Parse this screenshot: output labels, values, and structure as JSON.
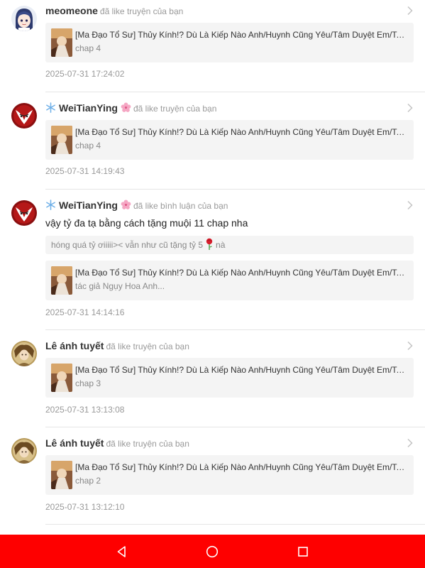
{
  "notifications": [
    {
      "username": "meomeone",
      "action": "đã like truyện của bạn",
      "avatar": "chibi-avatar",
      "book_title": "[Ma Đạo Tổ Sư] Thủy Kính!? Dù Là Kiếp Nào Anh/Huynh Cũng Yêu/Tâm Duyệt Em/Ta Đa...",
      "book_subtitle": "chap 4",
      "timestamp": "2025-07-31 17:24:02"
    },
    {
      "username": "WeiTianYing",
      "action": "đã like truyện của bạn",
      "avatar": "red-fox-avatar",
      "book_title": "[Ma Đạo Tổ Sư] Thủy Kính!? Dù Là Kiếp Nào Anh/Huynh Cũng Yêu/Tâm Duyệt Em/Ta Đa...",
      "book_subtitle": "chap 4",
      "timestamp": "2025-07-31 14:19:43"
    },
    {
      "username": "WeiTianYing",
      "action": "đã like bình luận của bạn",
      "avatar": "red-fox-avatar",
      "comment": "vậy tỷ đa tạ bằng cách tặng muội 11 chap nha",
      "quote_before": "hóng quá tỷ ơiiiii>< vẫn như cũ tặng tỷ 5",
      "quote_after": "nà",
      "book_title": "[Ma Đạo Tổ Sư] Thủy Kính!? Dù Là Kiếp Nào Anh/Huynh Cũng Yêu/Tâm Duyệt Em/Ta Đa...",
      "book_subtitle": "tác giả Ngụy Hoa Anh...",
      "timestamp": "2025-07-31 14:14:16"
    },
    {
      "username": "Lê ánh tuyết",
      "action": "đã like truyện của bạn",
      "avatar": "golden-portrait-avatar",
      "book_title": "[Ma Đạo Tổ Sư] Thủy Kính!? Dù Là Kiếp Nào Anh/Huynh Cũng Yêu/Tâm Duyệt Em/Ta Đa...",
      "book_subtitle": "chap 3",
      "timestamp": "2025-07-31 13:13:08"
    },
    {
      "username": "Lê ánh tuyết",
      "action": "đã like truyện của bạn",
      "avatar": "golden-portrait-avatar",
      "book_title": "[Ma Đạo Tổ Sư] Thủy Kính!? Dù Là Kiếp Nào Anh/Huynh Cũng Yêu/Tâm Duyệt Em/Ta Đa...",
      "book_subtitle": "chap 2",
      "timestamp": "2025-07-31 13:12:10"
    }
  ],
  "icons": {
    "chevron": "chevron-right-icon",
    "snowflake": "snowflake-icon",
    "blossom": "cherry-blossom-icon",
    "rose": "rose-icon"
  },
  "system_nav": {
    "back": "back-triangle-icon",
    "home": "home-circle-icon",
    "recents": "recents-square-icon",
    "bar_color": "#fe0000"
  }
}
